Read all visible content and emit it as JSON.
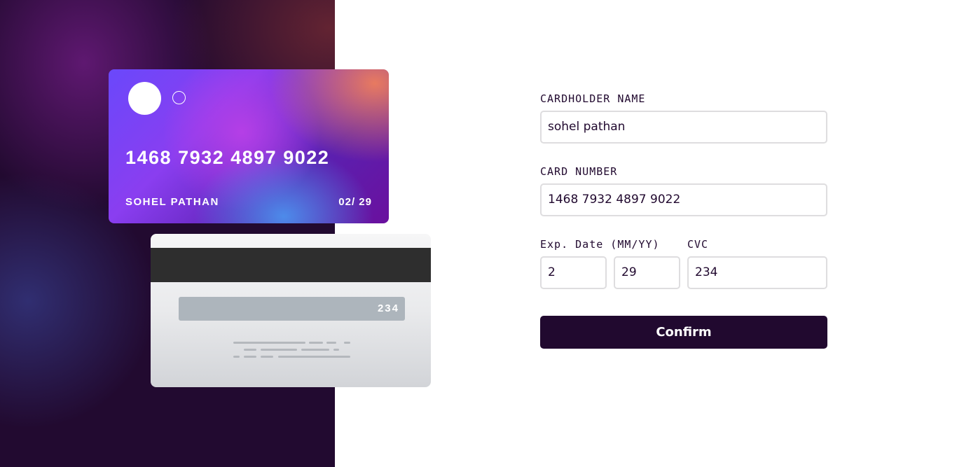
{
  "card_front": {
    "number": "1468 7932 4897 9022",
    "name": "SOHEL PATHAN",
    "expiry": "02/ 29"
  },
  "card_back": {
    "cvc": "234"
  },
  "form": {
    "name_label": "CARDHOLDER NAME",
    "name_value": "sohel pathan",
    "number_label": "CARD NUMBER",
    "number_value": "1468 7932 4897 9022",
    "exp_label": "Exp. Date (MM/YY)",
    "exp_month_value": "2",
    "exp_year_value": "29",
    "cvc_label": "CVC",
    "cvc_value": "234",
    "confirm_label": "Confirm"
  },
  "colors": {
    "dark_violet": "#21092f",
    "input_border": "#dedddf",
    "page_bg": "#ffffff"
  }
}
